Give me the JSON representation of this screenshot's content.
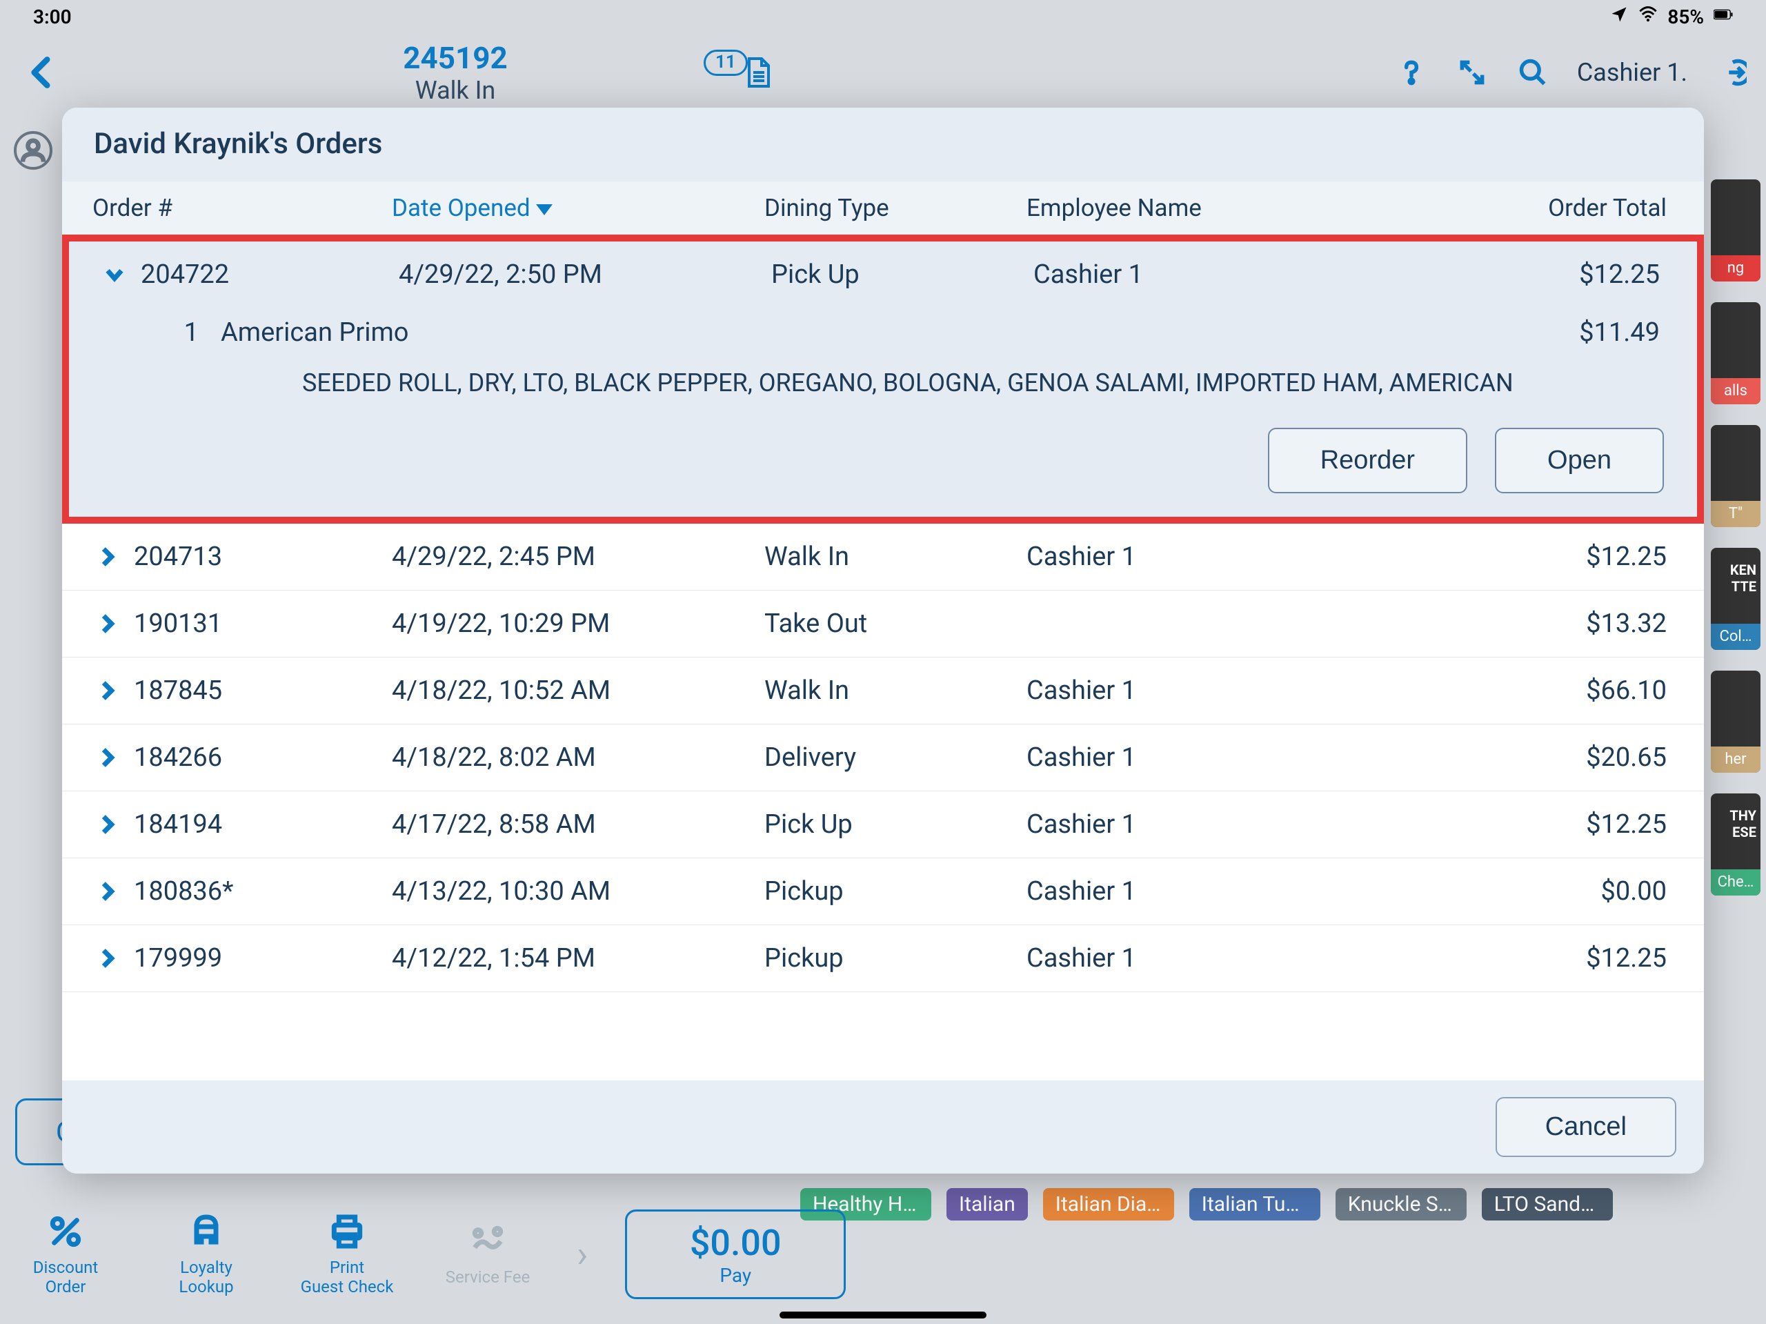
{
  "status": {
    "time": "3:00",
    "battery": "85%"
  },
  "header": {
    "order_number": "245192",
    "order_type": "Walk In",
    "doc_count": "11",
    "cashier": "Cashier 1."
  },
  "modal": {
    "title": "David Kraynik's Orders",
    "columns": {
      "order": "Order #",
      "date": "Date Opened",
      "dining": "Dining Type",
      "employee": "Employee Name",
      "total": "Order Total"
    },
    "expanded": {
      "order": "204722",
      "date": "4/29/22, 2:50 PM",
      "dining": "Pick Up",
      "employee": "Cashier 1",
      "total": "$12.25",
      "item_qty": "1",
      "item_name": "American Primo",
      "item_price": "$11.49",
      "modifiers": "SEEDED ROLL, DRY, LTO, BLACK PEPPER, OREGANO, BOLOGNA, GENOA SALAMI, IMPORTED HAM, AMERICAN",
      "reorder": "Reorder",
      "open": "Open"
    },
    "rows": [
      {
        "order": "204713",
        "date": "4/29/22, 2:45 PM",
        "dining": "Walk In",
        "employee": "Cashier 1",
        "total": "$12.25"
      },
      {
        "order": "190131",
        "date": "4/19/22, 10:29 PM",
        "dining": "Take Out",
        "employee": "",
        "total": "$13.32"
      },
      {
        "order": "187845",
        "date": "4/18/22, 10:52 AM",
        "dining": "Walk In",
        "employee": "Cashier 1",
        "total": "$66.10"
      },
      {
        "order": "184266",
        "date": "4/18/22, 8:02 AM",
        "dining": "Delivery",
        "employee": "Cashier 1",
        "total": "$20.65"
      },
      {
        "order": "184194",
        "date": "4/17/22, 8:58 AM",
        "dining": "Pick Up",
        "employee": "Cashier 1",
        "total": "$12.25"
      },
      {
        "order": "180836*",
        "date": "4/13/22, 10:30 AM",
        "dining": "Pickup",
        "employee": "Cashier 1",
        "total": "$0.00"
      },
      {
        "order": "179999",
        "date": "4/12/22, 1:54 PM",
        "dining": "Pickup",
        "employee": "Cashier 1",
        "total": "$12.25"
      }
    ],
    "cancel": "Cancel"
  },
  "bg_tiles": [
    {
      "cap": "ng",
      "cls": "cap-red"
    },
    {
      "cap": "alls",
      "cls": "cap-red2"
    },
    {
      "cap": "T\"",
      "cls": "cap-beige"
    },
    {
      "cap": "Col…",
      "cls": "cap-blue",
      "extra": "KEN\nTTE"
    },
    {
      "cap": "her",
      "cls": "cap-beige"
    },
    {
      "cap": "Che…",
      "cls": "cap-green",
      "extra": "THY\nESE"
    }
  ],
  "chips": [
    {
      "label": "Healthy Ha…",
      "cls": "green"
    },
    {
      "label": "Italian",
      "cls": "purple"
    },
    {
      "label": "Italian Diablo",
      "cls": "orange"
    },
    {
      "label": "Italian Tuna",
      "cls": "blue"
    },
    {
      "label": "Knuckle Sa…",
      "cls": "gray"
    },
    {
      "label": "LTO Sandwi…",
      "cls": "slate"
    }
  ],
  "bottom": {
    "discount": "Discount\nOrder",
    "loyalty": "Loyalty\nLookup",
    "print": "Print\nGuest Check",
    "service": "Service Fee",
    "pay_amount": "$0.00",
    "pay_label": "Pay"
  },
  "cut_button": "C"
}
